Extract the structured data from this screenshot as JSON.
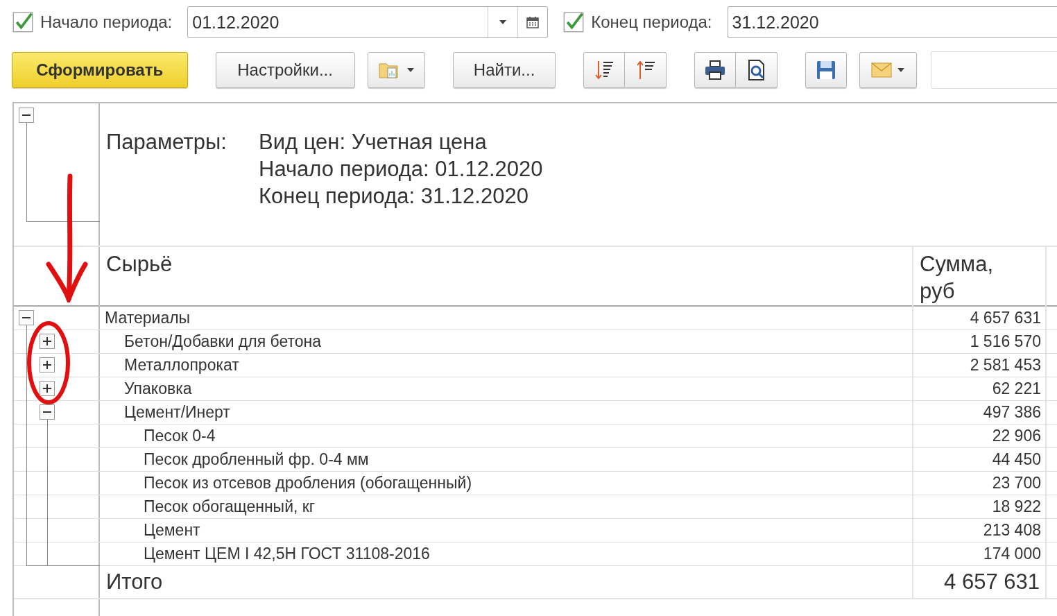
{
  "period_start": {
    "checked": true,
    "label": "Начало периода:",
    "value": "01.12.2020"
  },
  "period_end": {
    "checked": true,
    "label": "Конец периода:",
    "value": "31.12.2020"
  },
  "toolbar": {
    "generate_button": "Сформировать",
    "settings_button": "Настройки...",
    "find_button": "Найти..."
  },
  "report": {
    "parameters_expanded": true,
    "parameters_label": "Параметры:",
    "parameters": [
      "Вид цен: Учетная цена",
      "Начало периода: 01.12.2020",
      "Конец периода: 31.12.2020"
    ],
    "columns": [
      "Сырьё",
      "Сумма, руб"
    ],
    "rows": [
      {
        "name": "Материалы",
        "amount": "4 657 631",
        "expanded": true,
        "children": [
          {
            "name": "Бетон/Добавки для бетона",
            "amount": "1 516 570",
            "expanded": false
          },
          {
            "name": "Металлопрокат",
            "amount": "2 581 453",
            "expanded": false
          },
          {
            "name": "Упаковка",
            "amount": "62 221",
            "expanded": false
          },
          {
            "name": "Цемент/Инерт",
            "amount": "497 386",
            "expanded": true,
            "children": [
              {
                "name": "Песок 0-4",
                "amount": "22 906"
              },
              {
                "name": "Песок дробленный фр. 0-4 мм",
                "amount": "44 450"
              },
              {
                "name": "Песок из отсевов дробления (обогащенный)",
                "amount": "23 700"
              },
              {
                "name": "Песок обогащенный, кг",
                "amount": "18 922"
              },
              {
                "name": "Цемент",
                "amount": "213 408"
              },
              {
                "name": "Цемент ЦЕМ I 42,5Н ГОСТ 31108-2016",
                "amount": "174 000"
              }
            ]
          }
        ]
      }
    ],
    "total": {
      "label": "Итого",
      "amount": "4 657 631"
    }
  }
}
